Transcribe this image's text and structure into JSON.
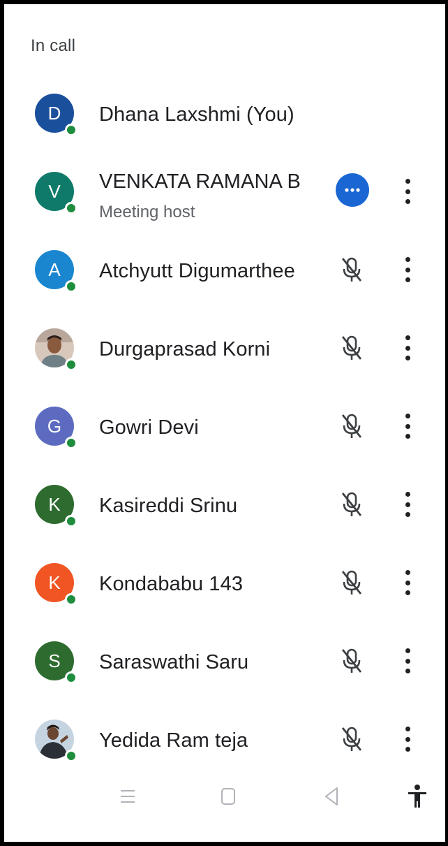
{
  "section_title": "In call",
  "participants": [
    {
      "initial": "D",
      "name": "Dhana Laxshmi (You)",
      "subtitle": "",
      "avatar_color": "#1a4f9c",
      "avatar_type": "letter",
      "action": "none"
    },
    {
      "initial": "V",
      "name": "VENKATA RAMANA B",
      "subtitle": "Meeting host",
      "avatar_color": "#0f7a6a",
      "avatar_type": "letter",
      "action": "more-options-blue"
    },
    {
      "initial": "A",
      "name": "Atchyutt Digumarthee",
      "subtitle": "",
      "avatar_color": "#1a86d0",
      "avatar_type": "letter",
      "action": "mic-off"
    },
    {
      "initial": "",
      "name": "Durgaprasad Korni",
      "subtitle": "",
      "avatar_color": "#c9a38a",
      "avatar_type": "photo",
      "action": "mic-off"
    },
    {
      "initial": "G",
      "name": "Gowri Devi",
      "subtitle": "",
      "avatar_color": "#5c6bc0",
      "avatar_type": "letter",
      "action": "mic-off"
    },
    {
      "initial": "K",
      "name": "Kasireddi Srinu",
      "subtitle": "",
      "avatar_color": "#2e6b2f",
      "avatar_type": "letter",
      "action": "mic-off"
    },
    {
      "initial": "K",
      "name": "Kondababu 143",
      "subtitle": "",
      "avatar_color": "#f05523",
      "avatar_type": "letter",
      "action": "mic-off"
    },
    {
      "initial": "S",
      "name": "Saraswathi Saru",
      "subtitle": "",
      "avatar_color": "#2e6b2f",
      "avatar_type": "letter",
      "action": "mic-off"
    },
    {
      "initial": "",
      "name": "Yedida Ram teja",
      "subtitle": "",
      "avatar_color": "#7a8fa8",
      "avatar_type": "photo",
      "action": "mic-off"
    }
  ],
  "icons": {
    "presence": "online-dot-icon",
    "mic_off": "mic-off-icon",
    "more_options": "more-horizontal-icon",
    "kebab": "more-vertical-icon",
    "nav_recents": "recents-icon",
    "nav_home": "home-icon",
    "nav_back": "back-icon",
    "nav_accessibility": "accessibility-icon"
  },
  "colors": {
    "presence_green": "#1e8e3e",
    "host_button_blue": "#1a66d2",
    "text_primary": "#202124",
    "text_secondary": "#5f6368"
  }
}
